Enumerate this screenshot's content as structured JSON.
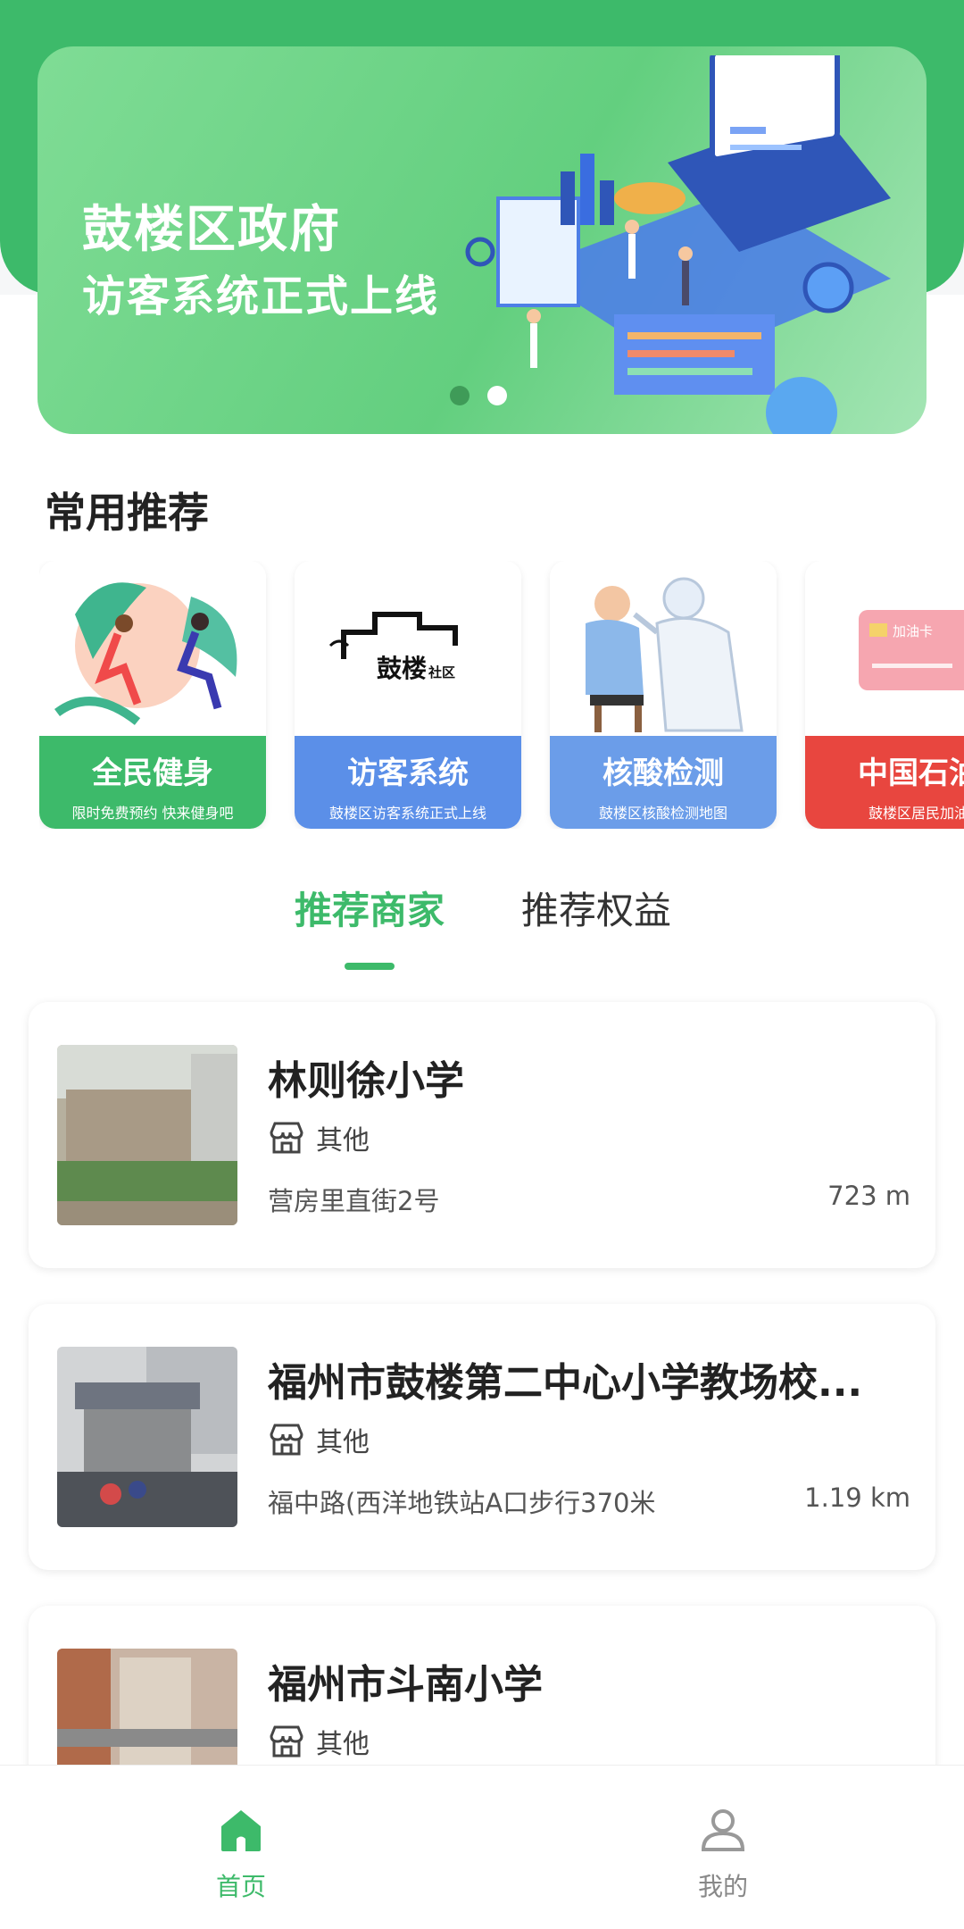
{
  "banner": {
    "title": "鼓楼区政府",
    "subtitle": "访客系统正式上线",
    "pages": 2,
    "active_page": 1
  },
  "section": {
    "title": "常用推荐"
  },
  "recommend": [
    {
      "title": "全民健身",
      "subtitle": "限时免费预约 快来健身吧",
      "color": "#3dba6a"
    },
    {
      "title": "访客系统",
      "subtitle": "鼓楼区访客系统正式上线",
      "color": "#5b8fe8",
      "logo_text": "鼓楼 社区"
    },
    {
      "title": "核酸检测",
      "subtitle": "鼓楼区核酸检测地图",
      "color": "#6b9de9"
    },
    {
      "title": "中国石油",
      "subtitle": "鼓楼区居民加油",
      "color": "#e8463f",
      "card_text": "加油卡"
    }
  ],
  "tabs": [
    {
      "label": "推荐商家",
      "active": true
    },
    {
      "label": "推荐权益",
      "active": false
    }
  ],
  "merchants": [
    {
      "name": "林则徐小学",
      "category": "其他",
      "address": "营房里直街2号",
      "distance": "723 m"
    },
    {
      "name": "福州市鼓楼第二中心小学教场校...",
      "category": "其他",
      "address": "福中路(西洋地铁站A口步行370米",
      "distance": "1.19 km"
    },
    {
      "name": "福州市斗南小学",
      "category": "其他",
      "address": "",
      "distance": ""
    }
  ],
  "nav": {
    "home": "首页",
    "mine": "我的"
  },
  "colors": {
    "accent": "#3dba6a"
  }
}
